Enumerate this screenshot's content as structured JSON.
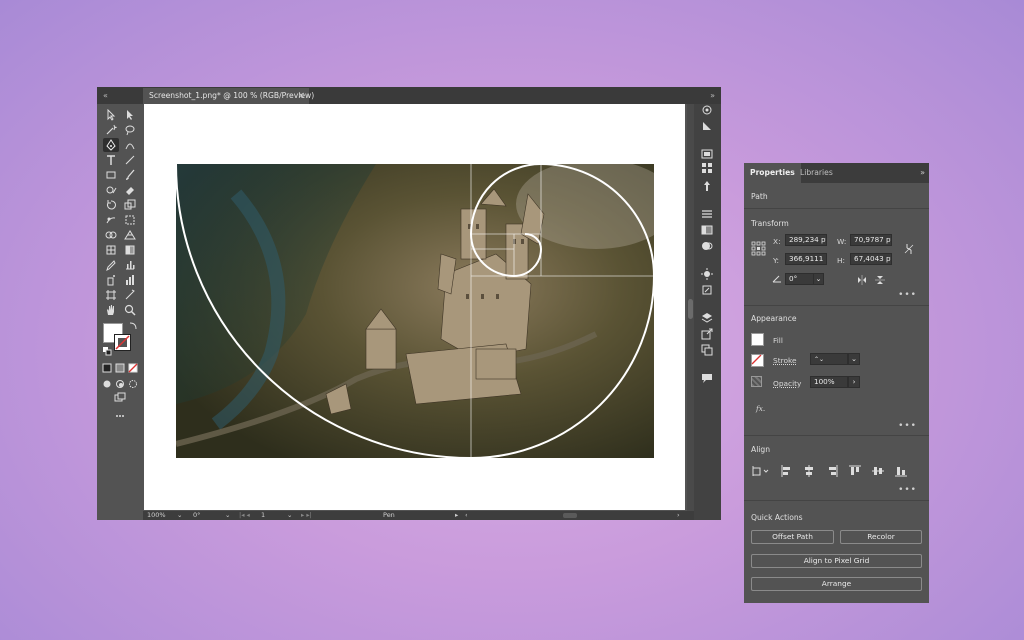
{
  "app": {
    "tab_label": "Screenshot_1.png* @ 100 % (RGB/Preview)",
    "tab_close": "×",
    "collapse_left": "«",
    "collapse_right": "»"
  },
  "statusbar": {
    "zoom": "100%",
    "rotation": "0°",
    "artboard": "1",
    "tool": "Pen"
  },
  "panel": {
    "tabs": [
      "Properties",
      "Libraries"
    ],
    "menu": "»",
    "object_type": "Path",
    "transform": {
      "title": "Transform",
      "x_label": "X:",
      "x_value": "289,234 pt",
      "y_label": "Y:",
      "y_value": "366,9111 pt",
      "w_label": "W:",
      "w_value": "70,9787 pt",
      "h_label": "H:",
      "h_value": "67,4043 pt",
      "angle_value": "0°"
    },
    "appearance": {
      "title": "Appearance",
      "fill_label": "Fill",
      "stroke_label": "Stroke",
      "opacity_label": "Opacity",
      "opacity_value": "100%",
      "fx_label": "fx."
    },
    "align": {
      "title": "Align"
    },
    "quick_actions": {
      "title": "Quick Actions",
      "offset_path": "Offset Path",
      "recolor": "Recolor",
      "align_pixel": "Align to Pixel Grid",
      "arrange": "Arrange"
    },
    "more": "•••"
  },
  "colors": {
    "ui_dark": "#535353",
    "ui_darker": "#3a3a3a",
    "background": "#c99bdc"
  }
}
